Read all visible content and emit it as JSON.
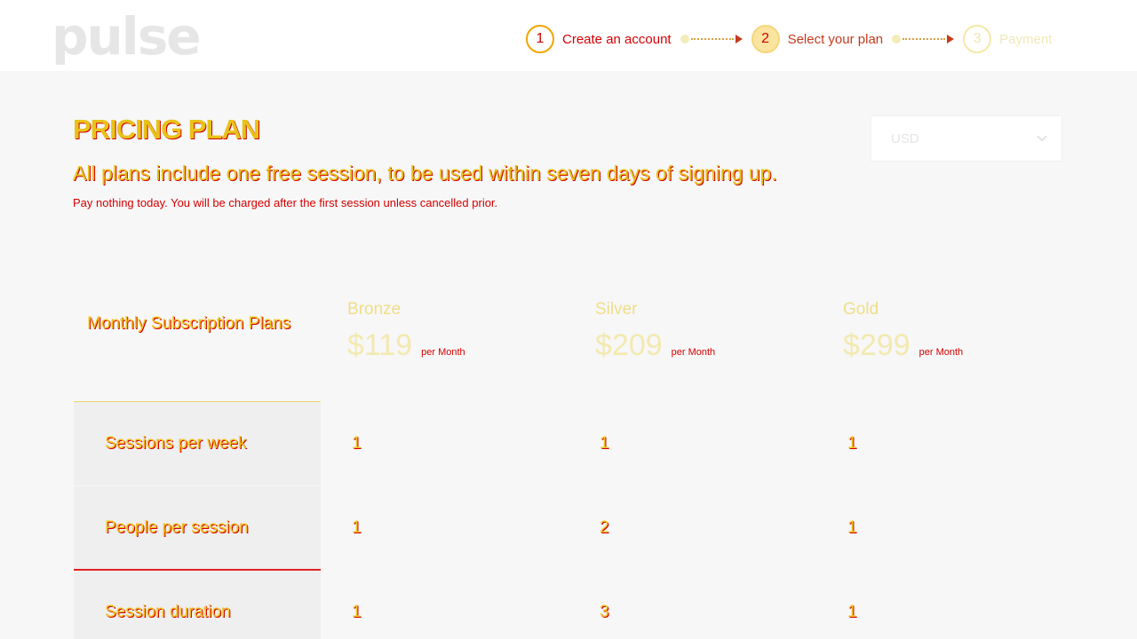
{
  "brand": {
    "logo_text": "pulse"
  },
  "steps": [
    {
      "number": "1",
      "label": "Create an account",
      "state": "done"
    },
    {
      "number": "2",
      "label": "Select your plan",
      "state": "active"
    },
    {
      "number": "3",
      "label": "Payment",
      "state": "pending"
    }
  ],
  "pricing": {
    "title": "PRICING PLAN",
    "subtitle": "All plans include one free session, to be used within seven days of signing up.",
    "note": "Pay nothing today. You will be charged after the first session unless cancelled prior.",
    "currency": {
      "selected": "USD"
    },
    "plans_label": "Monthly Subscription Plans",
    "plans": [
      {
        "name": "Bronze",
        "price": "$119",
        "unit": "per Month"
      },
      {
        "name": "Silver",
        "price": "$209",
        "unit": "per Month"
      },
      {
        "name": "Gold",
        "price": "$299",
        "unit": "per Month"
      }
    ],
    "rows": [
      {
        "label": "Sessions per week",
        "values": [
          "1",
          "1",
          "1"
        ]
      },
      {
        "label": "People per session",
        "values": [
          "1",
          "2",
          "1"
        ]
      },
      {
        "label": "Session duration",
        "values": [
          "1",
          "3",
          "1"
        ]
      }
    ]
  },
  "colors": {
    "accent": "#e8c21a",
    "accent_outline": "#d40000"
  }
}
